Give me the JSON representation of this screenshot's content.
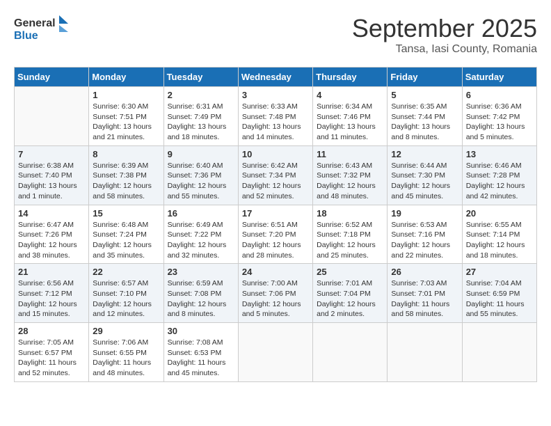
{
  "header": {
    "logo_general": "General",
    "logo_blue": "Blue",
    "month": "September 2025",
    "location": "Tansa, Iasi County, Romania"
  },
  "weekdays": [
    "Sunday",
    "Monday",
    "Tuesday",
    "Wednesday",
    "Thursday",
    "Friday",
    "Saturday"
  ],
  "weeks": [
    [
      {
        "day": "",
        "info": ""
      },
      {
        "day": "1",
        "info": "Sunrise: 6:30 AM\nSunset: 7:51 PM\nDaylight: 13 hours\nand 21 minutes."
      },
      {
        "day": "2",
        "info": "Sunrise: 6:31 AM\nSunset: 7:49 PM\nDaylight: 13 hours\nand 18 minutes."
      },
      {
        "day": "3",
        "info": "Sunrise: 6:33 AM\nSunset: 7:48 PM\nDaylight: 13 hours\nand 14 minutes."
      },
      {
        "day": "4",
        "info": "Sunrise: 6:34 AM\nSunset: 7:46 PM\nDaylight: 13 hours\nand 11 minutes."
      },
      {
        "day": "5",
        "info": "Sunrise: 6:35 AM\nSunset: 7:44 PM\nDaylight: 13 hours\nand 8 minutes."
      },
      {
        "day": "6",
        "info": "Sunrise: 6:36 AM\nSunset: 7:42 PM\nDaylight: 13 hours\nand 5 minutes."
      }
    ],
    [
      {
        "day": "7",
        "info": "Sunrise: 6:38 AM\nSunset: 7:40 PM\nDaylight: 13 hours\nand 1 minute."
      },
      {
        "day": "8",
        "info": "Sunrise: 6:39 AM\nSunset: 7:38 PM\nDaylight: 12 hours\nand 58 minutes."
      },
      {
        "day": "9",
        "info": "Sunrise: 6:40 AM\nSunset: 7:36 PM\nDaylight: 12 hours\nand 55 minutes."
      },
      {
        "day": "10",
        "info": "Sunrise: 6:42 AM\nSunset: 7:34 PM\nDaylight: 12 hours\nand 52 minutes."
      },
      {
        "day": "11",
        "info": "Sunrise: 6:43 AM\nSunset: 7:32 PM\nDaylight: 12 hours\nand 48 minutes."
      },
      {
        "day": "12",
        "info": "Sunrise: 6:44 AM\nSunset: 7:30 PM\nDaylight: 12 hours\nand 45 minutes."
      },
      {
        "day": "13",
        "info": "Sunrise: 6:46 AM\nSunset: 7:28 PM\nDaylight: 12 hours\nand 42 minutes."
      }
    ],
    [
      {
        "day": "14",
        "info": "Sunrise: 6:47 AM\nSunset: 7:26 PM\nDaylight: 12 hours\nand 38 minutes."
      },
      {
        "day": "15",
        "info": "Sunrise: 6:48 AM\nSunset: 7:24 PM\nDaylight: 12 hours\nand 35 minutes."
      },
      {
        "day": "16",
        "info": "Sunrise: 6:49 AM\nSunset: 7:22 PM\nDaylight: 12 hours\nand 32 minutes."
      },
      {
        "day": "17",
        "info": "Sunrise: 6:51 AM\nSunset: 7:20 PM\nDaylight: 12 hours\nand 28 minutes."
      },
      {
        "day": "18",
        "info": "Sunrise: 6:52 AM\nSunset: 7:18 PM\nDaylight: 12 hours\nand 25 minutes."
      },
      {
        "day": "19",
        "info": "Sunrise: 6:53 AM\nSunset: 7:16 PM\nDaylight: 12 hours\nand 22 minutes."
      },
      {
        "day": "20",
        "info": "Sunrise: 6:55 AM\nSunset: 7:14 PM\nDaylight: 12 hours\nand 18 minutes."
      }
    ],
    [
      {
        "day": "21",
        "info": "Sunrise: 6:56 AM\nSunset: 7:12 PM\nDaylight: 12 hours\nand 15 minutes."
      },
      {
        "day": "22",
        "info": "Sunrise: 6:57 AM\nSunset: 7:10 PM\nDaylight: 12 hours\nand 12 minutes."
      },
      {
        "day": "23",
        "info": "Sunrise: 6:59 AM\nSunset: 7:08 PM\nDaylight: 12 hours\nand 8 minutes."
      },
      {
        "day": "24",
        "info": "Sunrise: 7:00 AM\nSunset: 7:06 PM\nDaylight: 12 hours\nand 5 minutes."
      },
      {
        "day": "25",
        "info": "Sunrise: 7:01 AM\nSunset: 7:04 PM\nDaylight: 12 hours\nand 2 minutes."
      },
      {
        "day": "26",
        "info": "Sunrise: 7:03 AM\nSunset: 7:01 PM\nDaylight: 11 hours\nand 58 minutes."
      },
      {
        "day": "27",
        "info": "Sunrise: 7:04 AM\nSunset: 6:59 PM\nDaylight: 11 hours\nand 55 minutes."
      }
    ],
    [
      {
        "day": "28",
        "info": "Sunrise: 7:05 AM\nSunset: 6:57 PM\nDaylight: 11 hours\nand 52 minutes."
      },
      {
        "day": "29",
        "info": "Sunrise: 7:06 AM\nSunset: 6:55 PM\nDaylight: 11 hours\nand 48 minutes."
      },
      {
        "day": "30",
        "info": "Sunrise: 7:08 AM\nSunset: 6:53 PM\nDaylight: 11 hours\nand 45 minutes."
      },
      {
        "day": "",
        "info": ""
      },
      {
        "day": "",
        "info": ""
      },
      {
        "day": "",
        "info": ""
      },
      {
        "day": "",
        "info": ""
      }
    ]
  ]
}
